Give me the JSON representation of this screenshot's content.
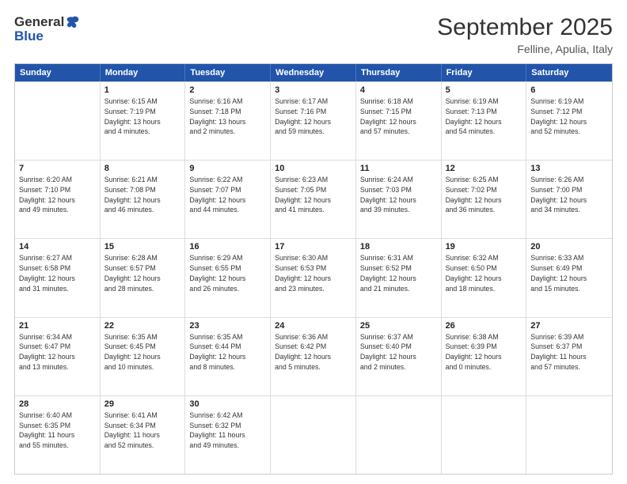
{
  "header": {
    "logo_general": "General",
    "logo_blue": "Blue",
    "month_title": "September 2025",
    "location": "Felline, Apulia, Italy"
  },
  "days_of_week": [
    "Sunday",
    "Monday",
    "Tuesday",
    "Wednesday",
    "Thursday",
    "Friday",
    "Saturday"
  ],
  "weeks": [
    [
      {
        "day": "",
        "info": ""
      },
      {
        "day": "1",
        "info": "Sunrise: 6:15 AM\nSunset: 7:19 PM\nDaylight: 13 hours\nand 4 minutes."
      },
      {
        "day": "2",
        "info": "Sunrise: 6:16 AM\nSunset: 7:18 PM\nDaylight: 13 hours\nand 2 minutes."
      },
      {
        "day": "3",
        "info": "Sunrise: 6:17 AM\nSunset: 7:16 PM\nDaylight: 12 hours\nand 59 minutes."
      },
      {
        "day": "4",
        "info": "Sunrise: 6:18 AM\nSunset: 7:15 PM\nDaylight: 12 hours\nand 57 minutes."
      },
      {
        "day": "5",
        "info": "Sunrise: 6:19 AM\nSunset: 7:13 PM\nDaylight: 12 hours\nand 54 minutes."
      },
      {
        "day": "6",
        "info": "Sunrise: 6:19 AM\nSunset: 7:12 PM\nDaylight: 12 hours\nand 52 minutes."
      }
    ],
    [
      {
        "day": "7",
        "info": "Sunrise: 6:20 AM\nSunset: 7:10 PM\nDaylight: 12 hours\nand 49 minutes."
      },
      {
        "day": "8",
        "info": "Sunrise: 6:21 AM\nSunset: 7:08 PM\nDaylight: 12 hours\nand 46 minutes."
      },
      {
        "day": "9",
        "info": "Sunrise: 6:22 AM\nSunset: 7:07 PM\nDaylight: 12 hours\nand 44 minutes."
      },
      {
        "day": "10",
        "info": "Sunrise: 6:23 AM\nSunset: 7:05 PM\nDaylight: 12 hours\nand 41 minutes."
      },
      {
        "day": "11",
        "info": "Sunrise: 6:24 AM\nSunset: 7:03 PM\nDaylight: 12 hours\nand 39 minutes."
      },
      {
        "day": "12",
        "info": "Sunrise: 6:25 AM\nSunset: 7:02 PM\nDaylight: 12 hours\nand 36 minutes."
      },
      {
        "day": "13",
        "info": "Sunrise: 6:26 AM\nSunset: 7:00 PM\nDaylight: 12 hours\nand 34 minutes."
      }
    ],
    [
      {
        "day": "14",
        "info": "Sunrise: 6:27 AM\nSunset: 6:58 PM\nDaylight: 12 hours\nand 31 minutes."
      },
      {
        "day": "15",
        "info": "Sunrise: 6:28 AM\nSunset: 6:57 PM\nDaylight: 12 hours\nand 28 minutes."
      },
      {
        "day": "16",
        "info": "Sunrise: 6:29 AM\nSunset: 6:55 PM\nDaylight: 12 hours\nand 26 minutes."
      },
      {
        "day": "17",
        "info": "Sunrise: 6:30 AM\nSunset: 6:53 PM\nDaylight: 12 hours\nand 23 minutes."
      },
      {
        "day": "18",
        "info": "Sunrise: 6:31 AM\nSunset: 6:52 PM\nDaylight: 12 hours\nand 21 minutes."
      },
      {
        "day": "19",
        "info": "Sunrise: 6:32 AM\nSunset: 6:50 PM\nDaylight: 12 hours\nand 18 minutes."
      },
      {
        "day": "20",
        "info": "Sunrise: 6:33 AM\nSunset: 6:49 PM\nDaylight: 12 hours\nand 15 minutes."
      }
    ],
    [
      {
        "day": "21",
        "info": "Sunrise: 6:34 AM\nSunset: 6:47 PM\nDaylight: 12 hours\nand 13 minutes."
      },
      {
        "day": "22",
        "info": "Sunrise: 6:35 AM\nSunset: 6:45 PM\nDaylight: 12 hours\nand 10 minutes."
      },
      {
        "day": "23",
        "info": "Sunrise: 6:35 AM\nSunset: 6:44 PM\nDaylight: 12 hours\nand 8 minutes."
      },
      {
        "day": "24",
        "info": "Sunrise: 6:36 AM\nSunset: 6:42 PM\nDaylight: 12 hours\nand 5 minutes."
      },
      {
        "day": "25",
        "info": "Sunrise: 6:37 AM\nSunset: 6:40 PM\nDaylight: 12 hours\nand 2 minutes."
      },
      {
        "day": "26",
        "info": "Sunrise: 6:38 AM\nSunset: 6:39 PM\nDaylight: 12 hours\nand 0 minutes."
      },
      {
        "day": "27",
        "info": "Sunrise: 6:39 AM\nSunset: 6:37 PM\nDaylight: 11 hours\nand 57 minutes."
      }
    ],
    [
      {
        "day": "28",
        "info": "Sunrise: 6:40 AM\nSunset: 6:35 PM\nDaylight: 11 hours\nand 55 minutes."
      },
      {
        "day": "29",
        "info": "Sunrise: 6:41 AM\nSunset: 6:34 PM\nDaylight: 11 hours\nand 52 minutes."
      },
      {
        "day": "30",
        "info": "Sunrise: 6:42 AM\nSunset: 6:32 PM\nDaylight: 11 hours\nand 49 minutes."
      },
      {
        "day": "",
        "info": ""
      },
      {
        "day": "",
        "info": ""
      },
      {
        "day": "",
        "info": ""
      },
      {
        "day": "",
        "info": ""
      }
    ]
  ]
}
